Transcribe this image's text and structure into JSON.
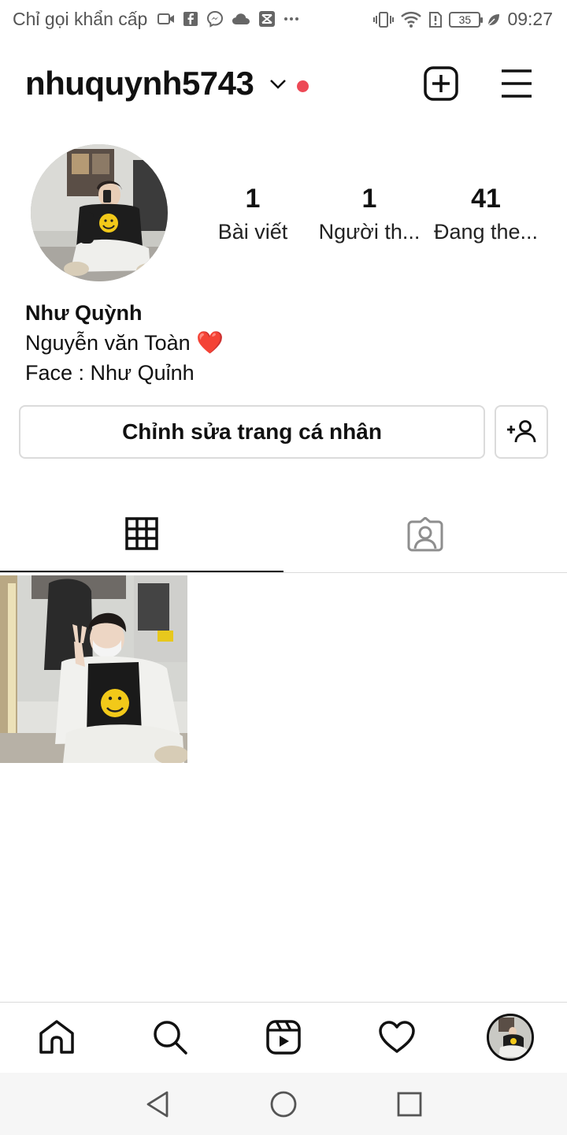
{
  "status_bar": {
    "carrier_text": "Chỉ gọi khẩn cấp",
    "battery_level": "35",
    "time": "09:27",
    "icons_left": [
      "video-call-icon",
      "facebook-icon",
      "messenger-icon",
      "cloud-icon",
      "capcut-icon",
      "more-dots-icon"
    ],
    "icons_right": [
      "vibrate-icon",
      "wifi-icon",
      "sim-alert-icon",
      "battery-icon",
      "leaf-icon"
    ]
  },
  "header": {
    "username": "nhuquynh5743",
    "has_unread_dot": true,
    "accent_color": "#ed4956"
  },
  "profile": {
    "stats": [
      {
        "value": "1",
        "label": "Bài viết"
      },
      {
        "value": "1",
        "label": "Người th..."
      },
      {
        "value": "41",
        "label": "Đang the..."
      }
    ],
    "name": "Như Quỳnh",
    "bio_line_1": "Nguyễn văn Toàn",
    "bio_line_1_emoji": "❤️",
    "bio_line_2": "Face : Như Quỉnh",
    "edit_button": "Chỉnh sửa trang cá nhân"
  },
  "tabs": [
    {
      "name": "grid",
      "icon": "grid-icon",
      "active": true
    },
    {
      "name": "tagged",
      "icon": "tagged-person-icon",
      "active": false
    }
  ],
  "posts_count_shown": 1,
  "bottom_nav": [
    "home-icon",
    "search-icon",
    "reels-icon",
    "heart-icon",
    "profile-avatar"
  ],
  "system_nav": [
    "back-icon",
    "home-circle-icon",
    "recents-icon"
  ]
}
